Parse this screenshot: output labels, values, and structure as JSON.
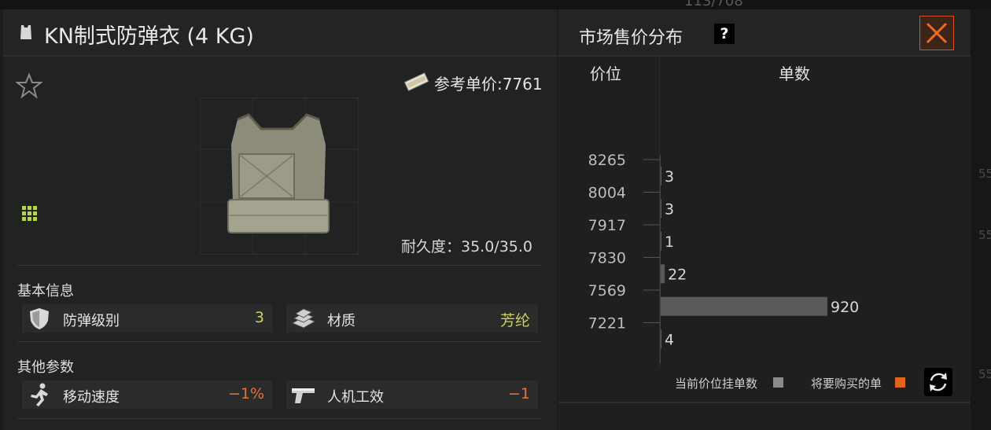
{
  "background_text": "113/708",
  "right_edge_numbers": [
    "55",
    "55",
    "55"
  ],
  "item": {
    "title": "KN制式防弹衣 (4 KG)",
    "reference_price": "参考单价:7761",
    "durability": "耐久度：35.0/35.0"
  },
  "sections": {
    "basic": "基本信息",
    "other": "其他参数"
  },
  "stats": {
    "protection_level": {
      "label": "防弹级别",
      "value": "3",
      "color": "#d2cf5a"
    },
    "material": {
      "label": "材质",
      "value": "芳纶",
      "color": "#d2cf5a"
    },
    "move_speed": {
      "label": "移动速度",
      "value": "−1%",
      "color": "#e0743a"
    },
    "ergonomics": {
      "label": "人机工效",
      "value": "−1",
      "color": "#e0743a"
    }
  },
  "market": {
    "title": "市场售价分布",
    "help": "?",
    "col_price": "价位",
    "col_count": "单数",
    "legend_current": "当前价位挂单数",
    "legend_buy": "将要购买的单",
    "current_color": "#8a8a8a",
    "buy_color": "#e0641e"
  },
  "chart_data": {
    "type": "bar",
    "orientation": "horizontal",
    "price_ticks": [
      "8265",
      "8004",
      "7917",
      "7830",
      "7569",
      "7221"
    ],
    "values": [
      3,
      3,
      1,
      22,
      920,
      4
    ],
    "value_labels": [
      "3",
      "3",
      "1",
      "22",
      "920",
      "4"
    ]
  }
}
